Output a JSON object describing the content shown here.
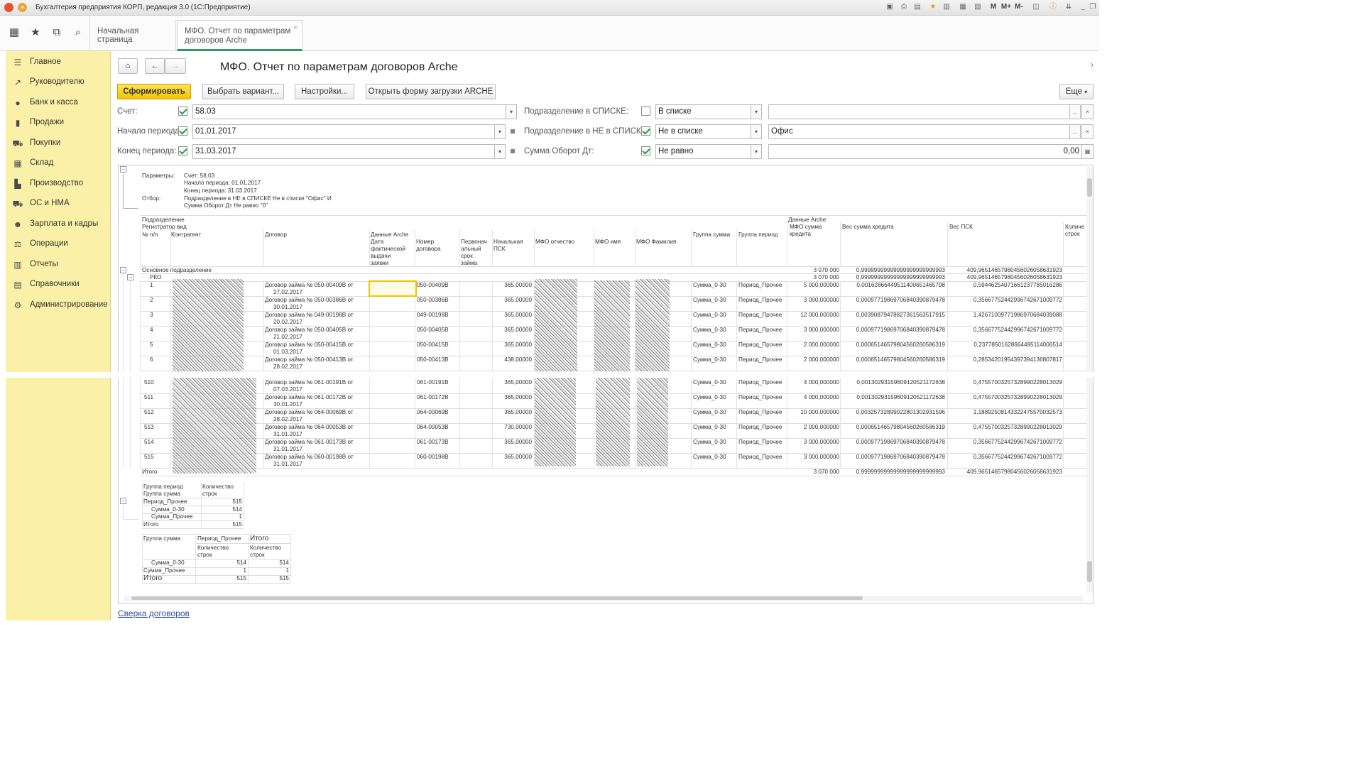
{
  "window": {
    "title": "Бухгалтерия предприятия КОРП, редакция 3.0  (1С:Предприятие)",
    "title_buttons": [
      "M",
      "M+",
      "M-"
    ]
  },
  "tabs": {
    "home": "Начальная страница",
    "report_line1": "МФО. Отчет по параметрам",
    "report_line2": "договоров  Arche",
    "close": "×"
  },
  "sidebar": {
    "items": [
      {
        "label": "Главное",
        "icon": "menu-icon"
      },
      {
        "label": "Руководителю",
        "icon": "chart-line-icon"
      },
      {
        "label": "Банк и касса",
        "icon": "coin-icon"
      },
      {
        "label": "Продажи",
        "icon": "bag-icon"
      },
      {
        "label": "Покупки",
        "icon": "cart-icon"
      },
      {
        "label": "Склад",
        "icon": "warehouse-icon"
      },
      {
        "label": "Производство",
        "icon": "factory-icon"
      },
      {
        "label": "ОС и НМА",
        "icon": "truck-icon"
      },
      {
        "label": "Зарплата и кадры",
        "icon": "person-icon"
      },
      {
        "label": "Операции",
        "icon": "balance-icon"
      },
      {
        "label": "Отчеты",
        "icon": "bar-chart-icon"
      },
      {
        "label": "Справочники",
        "icon": "book-icon"
      },
      {
        "label": "Администрирование",
        "icon": "gear-icon"
      }
    ]
  },
  "form": {
    "title": "МФО. Отчет по параметрам договоров  Arche",
    "buttons": {
      "generate": "Сформировать",
      "choose_variant": "Выбрать вариант...",
      "settings": "Настройки...",
      "open_arche": "Открыть форму загрузки ARCHE",
      "more": "Еще"
    },
    "filters": {
      "account_label": "Счет:",
      "account_value": "58.03",
      "start_label": "Начало периода:",
      "start_value": "01.01.2017",
      "end_label": "Конец периода:",
      "end_value": "31.03.2017",
      "dept_in_label": "Подразделение в СПИСКЕ:",
      "dept_in_mode": "В списке",
      "dept_notin_label": "Подразделение в НЕ в СПИСКЕ:",
      "dept_notin_mode": "Не в списке",
      "dept_notin_value": "Офис",
      "turnover_label": "Сумма Оборот Дт:",
      "turnover_mode": "Не равно",
      "turnover_value": "0,00"
    }
  },
  "report": {
    "params_label": "Параметры:",
    "params": [
      "Счет: 58.03",
      "Начало периода: 01.01.2017",
      "Конец периода: 31.03.2017"
    ],
    "filter_label": "Отбор:",
    "filter_text": [
      "Подразделение в НЕ в СПИСКЕ Не в списке \"Офис\" И",
      "Сумма Оборот Дт Не равно \"0\""
    ],
    "headers": {
      "dept": "Подразделение",
      "registrar": "Регистратор вид",
      "num": "№ п/п",
      "counterparty": "Контрагент",
      "contract": "Договор",
      "arche": "Данные Arche",
      "arche_right": "Данные Arche",
      "issue_date": [
        "Дата",
        "фактической",
        "выдачи",
        "заявки"
      ],
      "contract_no": [
        "Номер",
        "договора"
      ],
      "init_term": [
        "Первонач",
        "альный",
        "срок",
        "займа"
      ],
      "init_psk": [
        "Начальная",
        "ПСК"
      ],
      "patronymic": "МФО отчество",
      "name": "МФО имя",
      "surname": "МФО Фамилия",
      "sum_group": "Группа сумма",
      "period_group": "Группа период",
      "credit_sum": [
        "МФО сумма",
        "кредита"
      ],
      "credit_weight": "Вес сумма кредита",
      "psk_weight": "Вес ПСК",
      "row_count": [
        "Количе",
        "строк"
      ]
    },
    "summary_main": {
      "label": "Основное подразделение",
      "amount": "3 070 000",
      "weight": "0,99999999999999999999999993",
      "psk": "409,96514657980456026058631923"
    },
    "summary_rko": {
      "label": "РКО",
      "amount": "3 070 000",
      "weight": "0,99999999999999999999999993",
      "psk": "409,96514657980456026058631923"
    },
    "rows_top": [
      {
        "n": "1",
        "contract": [
          "Договор займа № 050-00409В от",
          "27.02.2017"
        ],
        "no": "050-00409В",
        "psk": "365,00000",
        "sg": "Сумма_0-30",
        "pg": "Период_Прочее",
        "sum": "5 000,000000",
        "w": "0,00162866449511400651465798",
        "pw": "0,59446254071661237785016286"
      },
      {
        "n": "2",
        "contract": [
          "Договор займа № 050-00386В от",
          "30.01.2017"
        ],
        "no": "050-00386В",
        "psk": "365,00000",
        "sg": "Сумма_0-30",
        "pg": "Период_Прочее",
        "sum": "3 000,000000",
        "w": "0,00097719869706840390879478",
        "pw": "0,35667752442996742671009772"
      },
      {
        "n": "3",
        "contract": [
          "Договор займа № 049-00198В от",
          "20.02.2017"
        ],
        "no": "049-00198В",
        "psk": "365,00000",
        "sg": "Сумма_0-30",
        "pg": "Период_Прочее",
        "sum": "12 000,000000",
        "w": "0,00390879478827361563517915",
        "pw": "1,42671009771986970684039088"
      },
      {
        "n": "4",
        "contract": [
          "Договор займа № 050-00405В от",
          "21.02.2017"
        ],
        "no": "050-00405В",
        "psk": "365,00000",
        "sg": "Сумма_0-30",
        "pg": "Период_Прочее",
        "sum": "3 000,000000",
        "w": "0,00097719869706840390879478",
        "pw": "0,35667752442996742671009772"
      },
      {
        "n": "5",
        "contract": [
          "Договор займа № 050-00415В от",
          "01.03.2017"
        ],
        "no": "050-00415В",
        "psk": "365,00000",
        "sg": "Сумма_0-30",
        "pg": "Период_Прочее",
        "sum": "2 000,000000",
        "w": "0,00065146579804560260586319",
        "pw": "0,23778501628664495114006514"
      },
      {
        "n": "6",
        "contract": [
          "Договор займа № 050-00413В от",
          "28.02.2017"
        ],
        "no": "050-00413В",
        "psk": "438,00000",
        "sg": "Сумма_0-30",
        "pg": "Период_Прочее",
        "sum": "2 000,000000",
        "w": "0,00065146579804560260586319",
        "pw": "0,28534201954397394136807817"
      }
    ],
    "rows_bottom": [
      {
        "n": "510",
        "contract": [
          "Договор займа № 061-00191В от",
          "07.03.2017"
        ],
        "no": "061-00191В",
        "psk": "365,00000",
        "sg": "Сумма_0-30",
        "pg": "Период_Прочее",
        "sum": "4 000,000000",
        "w": "0,00130293159609120521172638",
        "pw": "0,47557003257328990228013029"
      },
      {
        "n": "511",
        "contract": [
          "Договор займа № 061-00172В от",
          "30.01.2017"
        ],
        "no": "061-00172В",
        "psk": "365,00000",
        "sg": "Сумма_0-30",
        "pg": "Период_Прочее",
        "sum": "4 000,000000",
        "w": "0,00130293159609120521172638",
        "pw": "0,47557003257328990228013029"
      },
      {
        "n": "512",
        "contract": [
          "Договор займа № 064-00069В от",
          "28.02.2017"
        ],
        "no": "064-00069В",
        "psk": "365,00000",
        "sg": "Сумма_0-30",
        "pg": "Период_Прочее",
        "sum": "10 000,000000",
        "w": "0,00325732899022801302931596",
        "pw": "1,18892508143322475570032573"
      },
      {
        "n": "513",
        "contract": [
          "Договор займа № 064-00053В от",
          "31.01.2017"
        ],
        "no": "064-00053В",
        "psk": "730,00000",
        "sg": "Сумма_0-30",
        "pg": "Период_Прочее",
        "sum": "2 000,000000",
        "w": "0,00065146579804560260586319",
        "pw": "0,47557003257328990228013029"
      },
      {
        "n": "514",
        "contract": [
          "Договор займа № 061-00173В от",
          "31.01.2017"
        ],
        "no": "061-00173В",
        "psk": "365,00000",
        "sg": "Сумма_0-30",
        "pg": "Период_Прочее",
        "sum": "3 000,000000",
        "w": "0,00097719869706840390879478",
        "pw": "0,35667752442996742671009772"
      },
      {
        "n": "515",
        "contract": [
          "Договор займа № 060-00198В от",
          "31.01.2017"
        ],
        "no": "060-00198В",
        "psk": "365,00000",
        "sg": "Сумма_0-30",
        "pg": "Период_Прочее",
        "sum": "3 000,000000",
        "w": "0,00097719869706840390879478",
        "pw": "0,35667752442996742671009772"
      }
    ],
    "total": {
      "label": "Итого",
      "amount": "3 070 000",
      "weight": "0,99999999999999999999999993",
      "psk": "409,96514657980456026058631923"
    },
    "pivot1": {
      "h1": "Группа период",
      "h2": "Группа сумма",
      "count": [
        "Количество",
        "строк"
      ],
      "rows": [
        {
          "label": "Период_Прочее",
          "v": "515"
        },
        {
          "label": "Сумма_0-30",
          "v": "514"
        },
        {
          "label": "Сумма_Прочее",
          "v": "1"
        },
        {
          "label": "Итого",
          "v": "515"
        }
      ]
    },
    "pivot2": {
      "h1": "Группа сумма",
      "h2": "Период_Прочее",
      "h3": "Итого",
      "count": [
        "Количество",
        "строк"
      ],
      "rows": [
        {
          "label": "Сумма_0-30",
          "a": "514",
          "b": "514"
        },
        {
          "label": "Сумма_Прочее",
          "a": "1",
          "b": "1"
        },
        {
          "label": "Итого",
          "a": "515",
          "b": "515"
        }
      ]
    }
  },
  "footer_link": "Сверка договоров"
}
